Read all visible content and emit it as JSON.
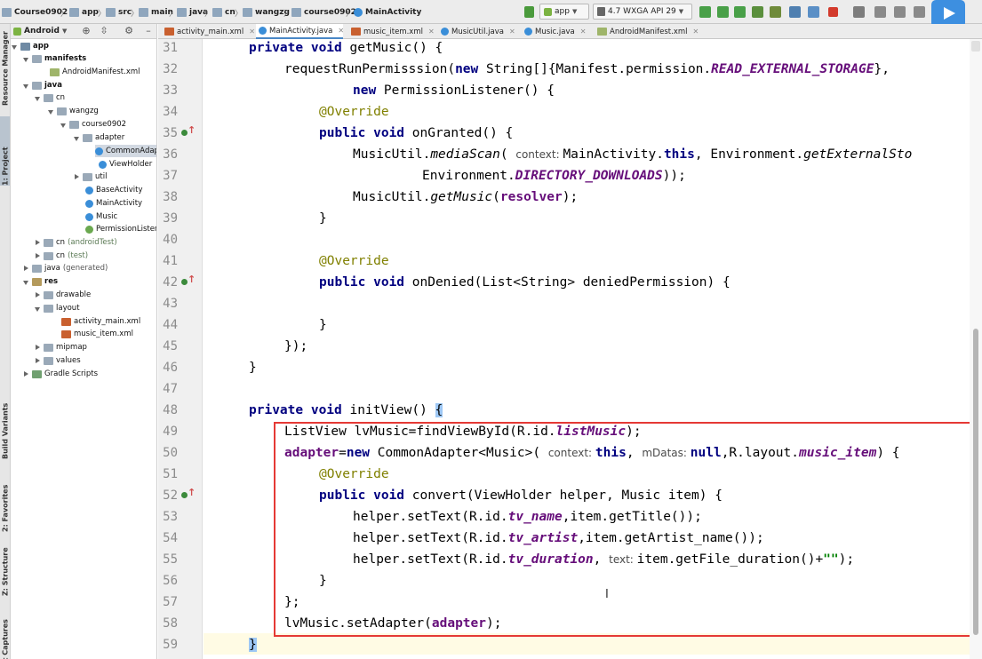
{
  "toolbar": {
    "breadcrumbs": [
      "Course0902",
      "app",
      "src",
      "main",
      "java",
      "cn",
      "wangzg",
      "course0902",
      "MainActivity"
    ],
    "run_config": "app",
    "device": "4.7  WXGA API 29"
  },
  "left_tool_tabs": [
    "Resource Manager",
    "1: Project",
    "Build Variants",
    "2: Favorites",
    "Z: Structure",
    "Layout Captures"
  ],
  "project_panel": {
    "view_mode": "Android",
    "tree": [
      {
        "label": "app",
        "type": "module",
        "expanded": true
      },
      {
        "label": "manifests",
        "type": "folder",
        "expanded": true
      },
      {
        "label": "AndroidManifest.xml",
        "type": "manifest"
      },
      {
        "label": "java",
        "type": "folder",
        "expanded": true
      },
      {
        "label": "cn",
        "type": "folder",
        "expanded": true
      },
      {
        "label": "wangzg",
        "type": "folder",
        "expanded": true
      },
      {
        "label": "course0902",
        "type": "folder",
        "expanded": true
      },
      {
        "label": "adapter",
        "type": "folder",
        "expanded": true
      },
      {
        "label": "CommonAdapter",
        "type": "class",
        "selected": true
      },
      {
        "label": "ViewHolder",
        "type": "class"
      },
      {
        "label": "util",
        "type": "folder",
        "expanded": false
      },
      {
        "label": "BaseActivity",
        "type": "class"
      },
      {
        "label": "MainActivity",
        "type": "class"
      },
      {
        "label": "Music",
        "type": "class"
      },
      {
        "label": "PermissionListener",
        "type": "interface"
      },
      {
        "label": "cn",
        "suffix": "(androidTest)",
        "type": "folder",
        "expanded": false
      },
      {
        "label": "cn",
        "suffix": "(test)",
        "type": "folder",
        "expanded": false
      },
      {
        "label": "java",
        "suffix": "(generated)",
        "type": "folder",
        "expanded": false
      },
      {
        "label": "res",
        "type": "res",
        "expanded": true
      },
      {
        "label": "drawable",
        "type": "folder",
        "expanded": false
      },
      {
        "label": "layout",
        "type": "folder",
        "expanded": true
      },
      {
        "label": "activity_main.xml",
        "type": "xml"
      },
      {
        "label": "music_item.xml",
        "type": "xml"
      },
      {
        "label": "mipmap",
        "type": "folder",
        "expanded": false
      },
      {
        "label": "values",
        "type": "folder",
        "expanded": false
      },
      {
        "label": "Gradle Scripts",
        "type": "gradle",
        "expanded": false
      }
    ]
  },
  "tabs": [
    {
      "label": "activity_main.xml",
      "active": false
    },
    {
      "label": "MainActivity.java",
      "active": true
    },
    {
      "label": "music_item.xml",
      "active": false
    },
    {
      "label": "MusicUtil.java",
      "active": false
    },
    {
      "label": "Music.java",
      "active": false
    },
    {
      "label": "AndroidManifest.xml",
      "active": false
    }
  ],
  "editor": {
    "line_numbers": [
      "31",
      "32",
      "33",
      "34",
      "35",
      "36",
      "37",
      "38",
      "39",
      "40",
      "41",
      "42",
      "43",
      "44",
      "45",
      "46",
      "47",
      "48",
      "49",
      "50",
      "51",
      "52",
      "53",
      "54",
      "55",
      "56",
      "57",
      "58",
      "59"
    ],
    "code": {
      "l31_kw": "private void ",
      "l31_rest": "getMusic() {",
      "l32_a": "requestRunPermisssion(",
      "l32_kw": "new ",
      "l32_b": "String[]{Manifest.permission.",
      "l32_fld": "READ_EXTERNAL_STORAGE",
      "l32_c": "},",
      "l33_kw": "new ",
      "l33_rest": "PermissionListener() {",
      "l34": "@Override",
      "l35_kw": "public void ",
      "l35_rest": "onGranted() {",
      "l36_a": "MusicUtil.",
      "l36_it": "mediaScan",
      "l36_b": "( ",
      "l36_hint": "context: ",
      "l36_c": "MainActivity.",
      "l36_kw": "this",
      "l36_d": ", Environment.",
      "l36_it2": "getExternalSto",
      "l37_a": "Environment.",
      "l37_fld": "DIRECTORY_DOWNLOADS",
      "l37_b": "));",
      "l38_a": "MusicUtil.",
      "l38_it": "getMusic",
      "l38_b": "(",
      "l38_fld": "resolver",
      "l38_c": ");",
      "l39": "}",
      "l41": "@Override",
      "l42_kw": "public void ",
      "l42_rest": "onDenied(List<String> deniedPermission) {",
      "l44": "}",
      "l45": "});",
      "l46": "}",
      "l48_kw": "private void ",
      "l48_rest": "initView() ",
      "l48_brace": "{",
      "l49_a": "ListView lvMusic=findViewById(R.id.",
      "l49_fld": "listMusic",
      "l49_b": ");",
      "l50_fld": "adapter",
      "l50_a": "=",
      "l50_kw": "new ",
      "l50_b": "CommonAdapter<Music>( ",
      "l50_hint1": "context: ",
      "l50_kw2": "this",
      "l50_c": ", ",
      "l50_hint2": "mDatas: ",
      "l50_kw3": "null",
      "l50_d": ",R.layout.",
      "l50_fld2": "music_item",
      "l50_e": ") {",
      "l51": "@Override",
      "l52_kw": "public void ",
      "l52_rest": "convert(ViewHolder helper, Music item) {",
      "l53_a": "helper.setText(R.id.",
      "l53_fld": "tv_name",
      "l53_b": ",item.getTitle());",
      "l54_a": "helper.setText(R.id.",
      "l54_fld": "tv_artist",
      "l54_b": ",item.getArtist_name());",
      "l55_a": "helper.setText(R.id.",
      "l55_fld": "tv_duration",
      "l55_b": ", ",
      "l55_hint": "text: ",
      "l55_c": "item.getFile_duration()+",
      "l55_str": "\"\"",
      "l55_d": ");",
      "l56": "}",
      "l57": "};",
      "l58_a": "lvMusic.setAdapter(",
      "l58_fld": "adapter",
      "l58_b": ");",
      "l59": "}"
    },
    "highlight_box_color": "#e53935"
  }
}
